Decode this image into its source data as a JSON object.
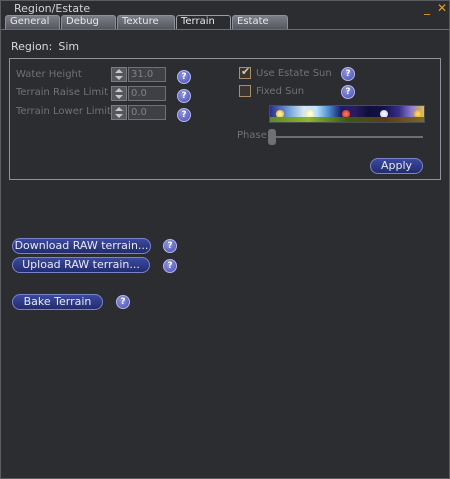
{
  "window": {
    "title": "Region/Estate",
    "minimize_glyph": "_",
    "close_glyph": "✕"
  },
  "tabs": [
    {
      "label": "General",
      "active": false
    },
    {
      "label": "Debug",
      "active": false
    },
    {
      "label": "Texture",
      "active": false
    },
    {
      "label": "Terrain",
      "active": true
    },
    {
      "label": "Estate",
      "active": false
    }
  ],
  "region": {
    "label": "Region:",
    "value": "Sim"
  },
  "terrain": {
    "water_height": {
      "label": "Water Height",
      "value": "31.0"
    },
    "raise_limit": {
      "label": "Terrain Raise Limit",
      "value": "0.0"
    },
    "lower_limit": {
      "label": "Terrain Lower Limit",
      "value": "0.0"
    }
  },
  "sun": {
    "use_estate_sun": {
      "label": "Use Estate Sun",
      "checked": true
    },
    "fixed_sun": {
      "label": "Fixed Sun",
      "checked": false
    },
    "phase_label": "Phase",
    "phase_value": 0.0
  },
  "buttons": {
    "apply": "Apply",
    "download_raw": "Download RAW terrain...",
    "upload_raw": "Upload RAW terrain...",
    "bake": "Bake Terrain"
  },
  "help_glyph": "?",
  "check_glyph": "✔",
  "colors": {
    "accent_button": "#2c3684",
    "help_icon": "#6a6fd0",
    "window_bg": "#2c2d30",
    "close_icon": "#e0a020"
  }
}
